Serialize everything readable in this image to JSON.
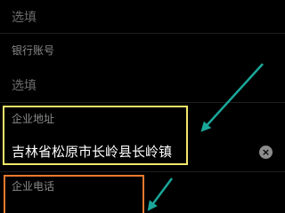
{
  "form": {
    "field_top_placeholder": "选填",
    "bank_account": {
      "label": "银行账号",
      "placeholder": "选填"
    },
    "company_address": {
      "label": "企业地址",
      "value": "吉林省松原市长岭县长岭镇"
    },
    "company_phone": {
      "label": "企业电话"
    }
  },
  "icons": {
    "clear": "close-circle-icon",
    "clear_glyph": "×"
  },
  "colors": {
    "background": "#000000",
    "address_highlight": "#f2e66b",
    "phone_highlight": "#f07a2e",
    "arrow": "#1aa79a"
  }
}
